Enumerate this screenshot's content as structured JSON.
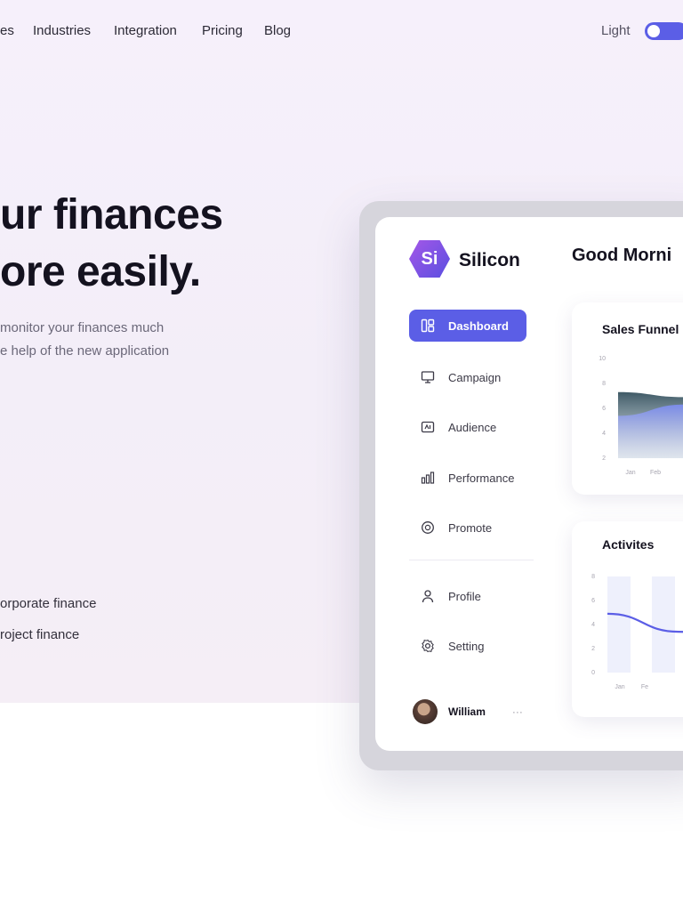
{
  "nav": {
    "links": [
      "es",
      "Industries",
      "Integration",
      "Pricing",
      "Blog"
    ],
    "mode_label": "Light",
    "mode_on": true
  },
  "hero": {
    "title_lines": [
      "ur finances",
      "ore easily."
    ],
    "subtitle_lines": [
      "monitor your finances much",
      "e help of the new application"
    ],
    "checklist": [
      "orporate finance",
      "roject finance"
    ]
  },
  "dashboard": {
    "brand": {
      "logo_letters": "Si",
      "name": "Silicon"
    },
    "greeting": "Good Morni",
    "sidebar": [
      {
        "label": "Dashboard",
        "icon": "dashboard-icon",
        "active": true
      },
      {
        "label": "Campaign",
        "icon": "monitor-icon",
        "active": false
      },
      {
        "label": "Audience",
        "icon": "audience-icon",
        "active": false
      },
      {
        "label": "Performance",
        "icon": "performance-icon",
        "active": false
      },
      {
        "label": "Promote",
        "icon": "promote-icon",
        "active": false
      },
      {
        "label": "Profile",
        "icon": "profile-icon",
        "active": false
      },
      {
        "label": "Setting",
        "icon": "settings-icon",
        "active": false
      }
    ],
    "user": {
      "name": "William",
      "more": "···"
    },
    "colors": {
      "accent": "#5b5ee6",
      "area_top": "#3f5a66",
      "area_bottom": "#6d7ff0"
    }
  },
  "chart_data": [
    {
      "type": "area",
      "title": "Sales Funnel",
      "y_ticks": [
        "10",
        "8",
        "6",
        "4",
        "2"
      ],
      "x_ticks": [
        "Jan",
        "Feb"
      ],
      "ylim": [
        2,
        10
      ],
      "series": [
        {
          "x": [
            0,
            0.5,
            1
          ],
          "values": [
            7.3,
            6.9,
            7.2
          ]
        },
        {
          "x": [
            0,
            0.5,
            1
          ],
          "values": [
            5.4,
            6.3,
            6.9
          ]
        }
      ]
    },
    {
      "type": "line",
      "title": "Activites",
      "y_ticks": [
        "8",
        "6",
        "4",
        "2",
        "0"
      ],
      "x_ticks": [
        "Jan",
        "Fe"
      ],
      "ylim": [
        0,
        8
      ],
      "series": [
        {
          "x": [
            0,
            0.5,
            1
          ],
          "values": [
            4.9,
            3.4,
            3.2
          ]
        }
      ]
    }
  ]
}
